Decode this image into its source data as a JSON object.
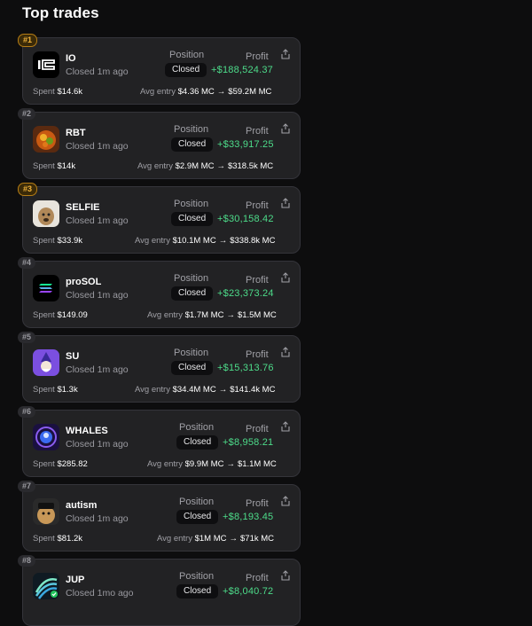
{
  "page": {
    "title": "Top trades"
  },
  "labels": {
    "position": "Position",
    "profit": "Profit",
    "spent": "Spent",
    "avg_entry": "Avg entry",
    "arrow": "→"
  },
  "trades": [
    {
      "rank": "#1",
      "name": "IO",
      "closed": "Closed 1m ago",
      "status": "Closed",
      "profit": "+$188,524.37",
      "spent": "$14.6k",
      "avg_entry": "$4.36 MC",
      "current": "$59.2M MC"
    },
    {
      "rank": "#2",
      "name": "RBT",
      "closed": "Closed 1m ago",
      "status": "Closed",
      "profit": "+$33,917.25",
      "spent": "$14k",
      "avg_entry": "$2.9M MC",
      "current": "$318.5k MC"
    },
    {
      "rank": "#3",
      "name": "SELFIE",
      "closed": "Closed 1m ago",
      "status": "Closed",
      "profit": "+$30,158.42",
      "spent": "$33.9k",
      "avg_entry": "$10.1M MC",
      "current": "$338.8k MC"
    },
    {
      "rank": "#4",
      "name": "proSOL",
      "closed": "Closed 1m ago",
      "status": "Closed",
      "profit": "+$23,373.24",
      "spent": "$149.09",
      "avg_entry": "$1.7M MC",
      "current": "$1.5M MC"
    },
    {
      "rank": "#5",
      "name": "SU",
      "closed": "Closed 1m ago",
      "status": "Closed",
      "profit": "+$15,313.76",
      "spent": "$1.3k",
      "avg_entry": "$34.4M MC",
      "current": "$141.4k MC"
    },
    {
      "rank": "#6",
      "name": "WHALES",
      "closed": "Closed 1m ago",
      "status": "Closed",
      "profit": "+$8,958.21",
      "spent": "$285.82",
      "avg_entry": "$9.9M MC",
      "current": "$1.1M MC"
    },
    {
      "rank": "#7",
      "name": "autism",
      "closed": "Closed 1m ago",
      "status": "Closed",
      "profit": "+$8,193.45",
      "spent": "$81.2k",
      "avg_entry": "$1M MC",
      "current": "$71k MC"
    },
    {
      "rank": "#8",
      "name": "JUP",
      "closed": "Closed 1mo ago",
      "status": "Closed",
      "profit": "+$8,040.72"
    }
  ],
  "colors": {
    "profit": "#4ddc8a",
    "gold_rank": "#f0b23b",
    "card": "#222224",
    "background": "#0d0d0e"
  },
  "icons": [
    "io-logo-icon",
    "rbt-logo-icon",
    "selfie-logo-icon",
    "prosol-logo-icon",
    "su-logo-icon",
    "whales-logo-icon",
    "autism-logo-icon",
    "jup-logo-icon",
    "share-icon"
  ]
}
